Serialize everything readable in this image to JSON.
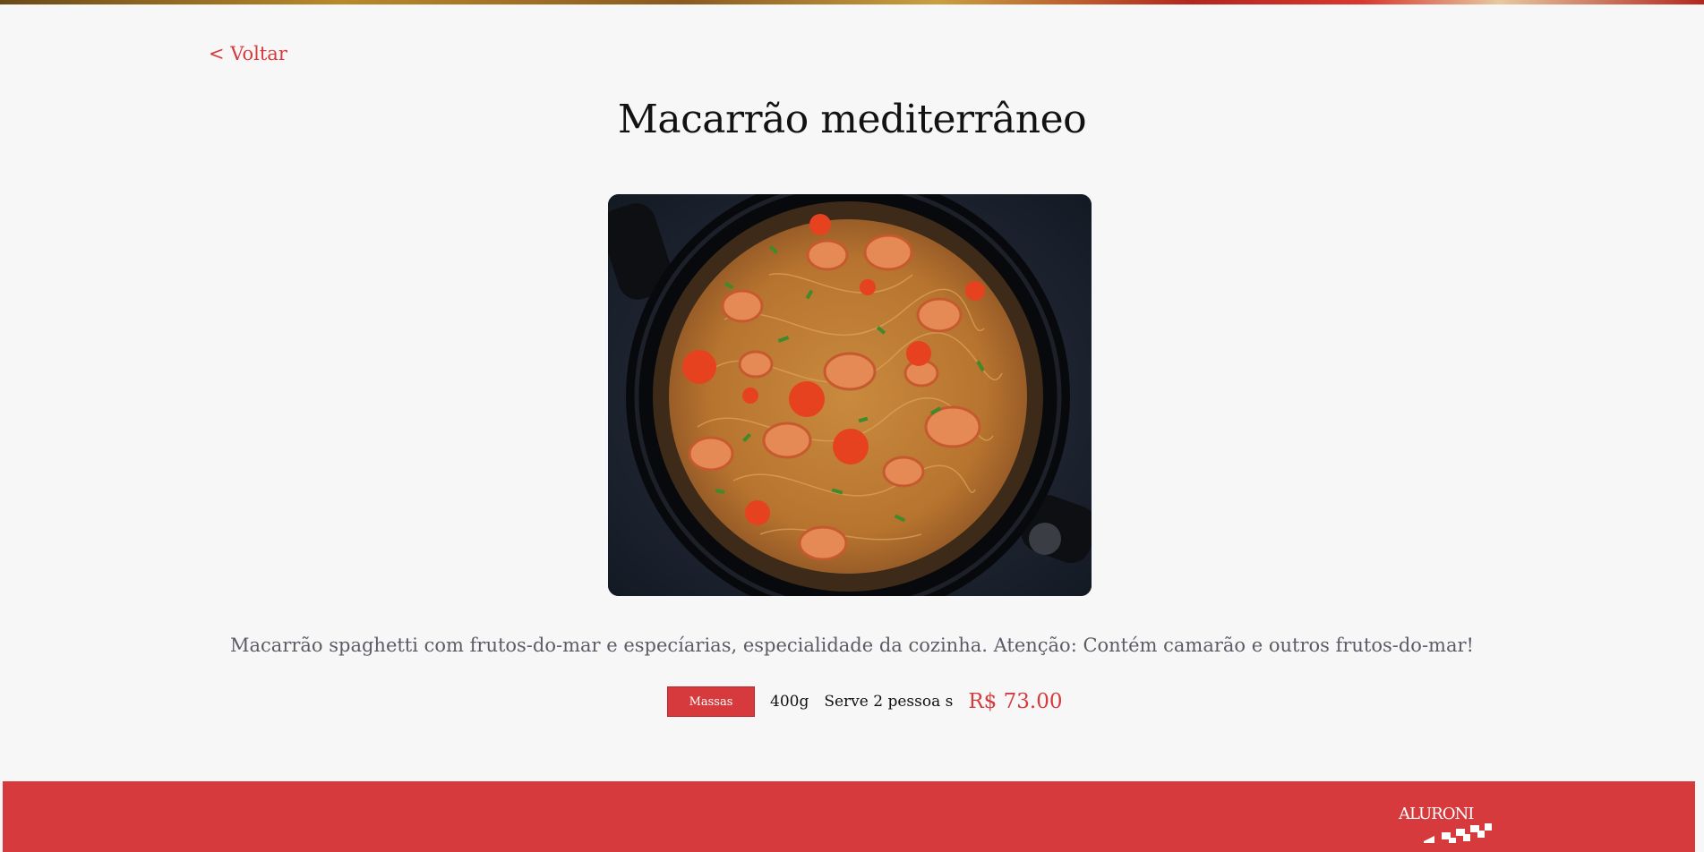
{
  "nav": {
    "back_label": "< Voltar"
  },
  "dish": {
    "title": "Macarrão mediterrâneo",
    "image_alt": "spaghetti-with-seafood-in-pan",
    "description": "Macarrão spaghetti com frutos-do-mar e especíarias, especialidade da cozinha. Atenção: Contém camarão e outros frutos-do-mar!",
    "category": "Massas",
    "weight": "400g",
    "serves": "Serve 2 pessoa s",
    "price": "R$ 73.00"
  },
  "footer": {
    "logo_text": "ALURONI"
  },
  "colors": {
    "accent": "#d63a3c",
    "background": "#f7f7f7",
    "text": "#121212",
    "muted": "#5c5c66"
  }
}
